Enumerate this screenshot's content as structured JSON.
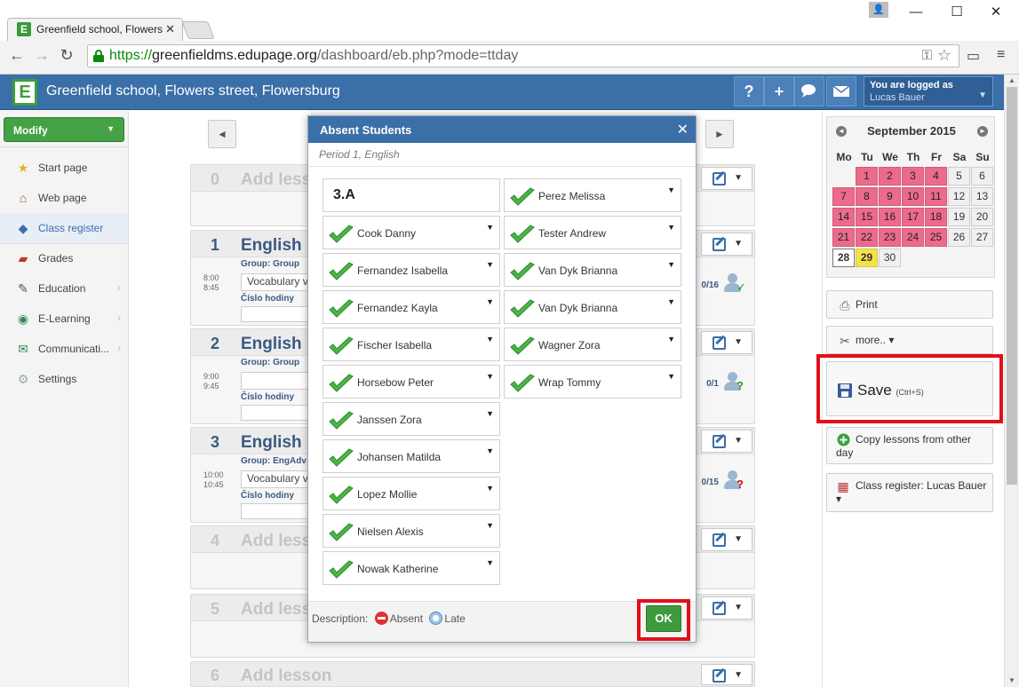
{
  "browser": {
    "tab_title": "Greenfield school, Flowers",
    "url_scheme": "https://",
    "url_host": "greenfieldms.edupage.org",
    "url_path": "/dashboard/eb.php?mode=ttday"
  },
  "app": {
    "school_name": "Greenfield school, Flowers street, Flowersburg",
    "header_buttons": [
      "?",
      "+"
    ],
    "logged_label": "You are logged as",
    "user_name": "Lucas Bauer"
  },
  "sidebar": {
    "modify_label": "Modify",
    "items": [
      {
        "label": "Start page",
        "icon": "star-icon"
      },
      {
        "label": "Web page",
        "icon": "web-page-icon"
      },
      {
        "label": "Class register",
        "icon": "class-register-icon"
      },
      {
        "label": "Grades",
        "icon": "grades-icon"
      },
      {
        "label": "Education",
        "icon": "education-icon"
      },
      {
        "label": "E-Learning",
        "icon": "e-learning-icon"
      },
      {
        "label": "Communicati...",
        "icon": "communication-icon"
      },
      {
        "label": "Settings",
        "icon": "settings-icon"
      }
    ]
  },
  "lessons": [
    {
      "num": "0",
      "subject": "Add less",
      "group": "",
      "time_start": "",
      "time_end": "",
      "topic": "",
      "count": ""
    },
    {
      "num": "1",
      "subject": "English",
      "group": "Group: Group",
      "time_start": "8:00",
      "time_end": "8:45",
      "topic": "Vocabulary v",
      "cislo": "Číslo hodiny",
      "count": "0/16"
    },
    {
      "num": "2",
      "subject": "English",
      "group": "Group: Group",
      "time_start": "9:00",
      "time_end": "9:45",
      "topic": "",
      "cislo": "Číslo hodiny",
      "count": "0/1"
    },
    {
      "num": "3",
      "subject": "English",
      "group": "Group: EngAdv",
      "time_start": "10:00",
      "time_end": "10:45",
      "topic": "Vocabulary v",
      "cislo": "Číslo hodiny",
      "count": "0/15"
    },
    {
      "num": "4",
      "subject": "Add less",
      "group": "",
      "time_start": "",
      "time_end": "",
      "topic": "",
      "count": ""
    },
    {
      "num": "5",
      "subject": "Add less",
      "group": "",
      "time_start": "",
      "time_end": "",
      "topic": "",
      "count": ""
    },
    {
      "num": "6",
      "subject": "Add lesson",
      "group": "",
      "time_start": "",
      "time_end": "",
      "topic": "",
      "count": ""
    }
  ],
  "modal": {
    "title": "Absent Students",
    "subtitle": "Period 1, English",
    "class_name": "3.A",
    "left_students": [
      "Cook Danny",
      "Fernandez Isabella",
      "Fernandez Kayla",
      "Fischer Isabella",
      "Horsebow Peter",
      "Janssen Zora",
      "Johansen Matilda",
      "Lopez Mollie",
      "Nielsen Alexis",
      "Nowak Katherine"
    ],
    "right_students": [
      "Perez Melissa",
      "Tester Andrew",
      "Van Dyk Brianna",
      "Van Dyk Brianna",
      "Wagner Zora",
      "Wrap Tommy"
    ],
    "description_label": "Description:",
    "absent_label": "Absent",
    "late_label": "Late",
    "ok_label": "OK"
  },
  "calendar": {
    "month": "September 2015",
    "dow": [
      "Mo",
      "Tu",
      "We",
      "Th",
      "Fr",
      "Sa",
      "Su"
    ],
    "weeks": [
      [
        "",
        "1",
        "2",
        "3",
        "4",
        "5",
        "6"
      ],
      [
        "7",
        "8",
        "9",
        "10",
        "11",
        "12",
        "13"
      ],
      [
        "14",
        "15",
        "16",
        "17",
        "18",
        "19",
        "20"
      ],
      [
        "21",
        "22",
        "23",
        "24",
        "25",
        "26",
        "27"
      ],
      [
        "28",
        "29",
        "30",
        "",
        "",
        "",
        ""
      ]
    ],
    "selected_day": "28",
    "today": "29"
  },
  "right_actions": {
    "print": "Print",
    "more": "more.. ▾",
    "save": "Save",
    "save_shortcut": "(Ctrl+S)",
    "copy_lessons": "Copy lessons from other day",
    "class_register": "Class register: Lucas Bauer ▾"
  },
  "colors": {
    "header_blue": "#3a6fa8",
    "green": "#45a145",
    "calendar_pink": "#ec6b8a",
    "today_yellow": "#f3e34a",
    "highlight_red": "#e0101a"
  }
}
